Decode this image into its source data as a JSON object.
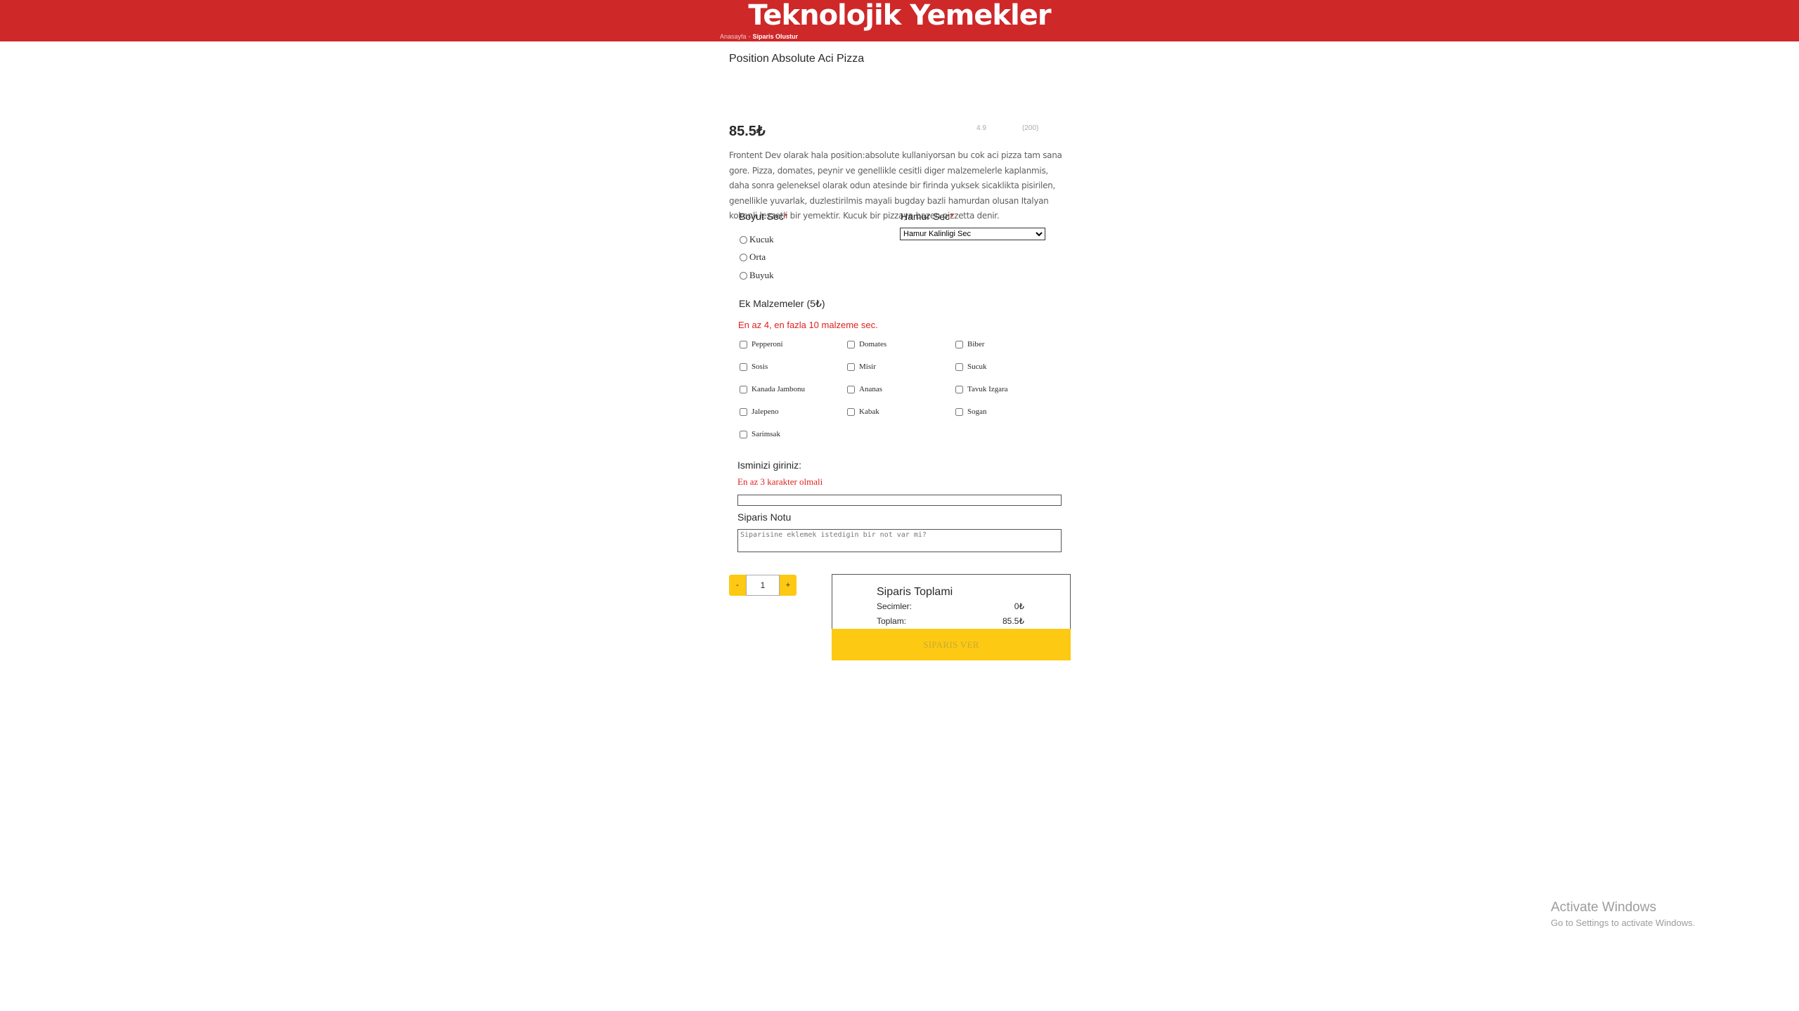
{
  "header": {
    "brand": "Teknolojik Yemekler",
    "breadcrumb_home": "Anasayfa",
    "breadcrumb_sep": "-",
    "breadcrumb_current": "Siparis Olustur",
    "bg_color": "#ce2829"
  },
  "product": {
    "title": "Position Absolute Aci Pizza",
    "price": "85.5₺",
    "rating": "4.9",
    "reviews": "(200)",
    "description": "Frontent Dev olarak hala position:absolute kullaniyorsan bu cok aci pizza tam sana gore. Pizza, domates, peynir ve genellikle cesitli diger malzemelerle kaplanmis, daha sonra geleneksel olarak odun atesinde bir firinda yuksek sicaklikta pisirilen, genellikle yuvarlak, duzlestirilmis mayali bugday bazli hamurdan olusan Italyan kokenli lezzetli bir yemektir. Kucuk bir pizzaya bazen pizzetta denir."
  },
  "size": {
    "label": "Boyut Sec",
    "required_mark": "*",
    "options": [
      "Kucuk",
      "Orta",
      "Buyuk"
    ]
  },
  "dough": {
    "label": "Hamur Sec",
    "required_mark": "*",
    "selected": "Hamur Kalinligi Sec"
  },
  "extras": {
    "label": "Ek Malzemeler (5₺)",
    "warning": "En az 4, en fazla 10 malzeme sec.",
    "items": [
      "Pepperoni",
      "Domates",
      "Biber",
      "Sosis",
      "Misir",
      "Sucuk",
      "Kanada Jambonu",
      "Ananas",
      "Tavuk Izgara",
      "Jalepeno",
      "Kabak",
      "Sogan",
      "Sarimsak"
    ]
  },
  "name": {
    "label": "Isminizi giriniz:",
    "warning": "En az 3 karakter olmali",
    "value": ""
  },
  "note": {
    "label": "Siparis Notu",
    "placeholder": "Siparisine eklemek istedigin bir not var mi?"
  },
  "quantity": {
    "minus": "-",
    "value": "1",
    "plus": "+"
  },
  "summary": {
    "title": "Siparis Toplami",
    "selections_label": "Secimler:",
    "selections_value": "0₺",
    "total_label": "Toplam:",
    "total_value": "85.5₺",
    "order_button": "SIPARIS VER",
    "accent_color": "#fdc913"
  },
  "watermark": {
    "line1": "Activate Windows",
    "line2": "Go to Settings to activate Windows."
  }
}
